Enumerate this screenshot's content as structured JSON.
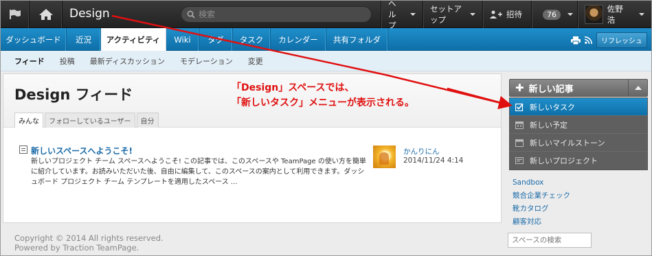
{
  "topbar": {
    "space_title": "Design",
    "search_placeholder": "検索",
    "help_label": "ヘルプ",
    "setup_label": "セットアップ",
    "invite_label": "招待",
    "notification_count": "76",
    "user_name": "佐野 浩"
  },
  "nav": {
    "tabs": [
      {
        "label": "ダッシュボード"
      },
      {
        "label": "近況"
      },
      {
        "label": "アクティビティ"
      },
      {
        "label": "Wiki"
      },
      {
        "label": "タグ"
      },
      {
        "label": "タスク"
      },
      {
        "label": "カレンダー"
      },
      {
        "label": "共有フォルダ"
      }
    ],
    "refresh_label": "リフレッシュ"
  },
  "subnav": {
    "items": [
      {
        "label": "フィード"
      },
      {
        "label": "投稿"
      },
      {
        "label": "最新ディスカッション"
      },
      {
        "label": "モデレーション"
      },
      {
        "label": "変更"
      }
    ]
  },
  "feed": {
    "title": "Design フィード",
    "tabs": [
      {
        "label": "みんな"
      },
      {
        "label": "フォローしているユーザー"
      },
      {
        "label": "自分"
      }
    ],
    "post": {
      "title": "新しいスペースへようこそ!",
      "body": "新しいプロジェクト チーム スペースへようこそ! この記事では、このスペースや TeamPage の使い方を簡単に紹介しています。お読みいただいた後、自由に編集して、このスペースの案内として利用できます。ダッシュボード プロジェクト チーム テンプレートを適用したスペース ...",
      "author": "かんりにん",
      "date": "2014/11/24 4:14"
    }
  },
  "annotation": {
    "line1": "「Design」スペースでは、",
    "line2": "「新しいタスク」メニューが表示される。",
    "color": "#e01010"
  },
  "sidebar": {
    "new_button_label": "新しい記事",
    "menu_items": [
      {
        "label": "新しいタスク",
        "icon": "checkbox-icon"
      },
      {
        "label": "新しい予定",
        "icon": "calendar-icon"
      },
      {
        "label": "新しいマイルストーン",
        "icon": "calendar-icon"
      },
      {
        "label": "新しいプロジェクト",
        "icon": "project-icon"
      }
    ],
    "links": [
      {
        "label": "Sandbox"
      },
      {
        "label": "競合企業チェック"
      },
      {
        "label": "靴カタログ"
      },
      {
        "label": "顧客対応"
      }
    ],
    "search_placeholder": "スペースの検索"
  },
  "footer": {
    "copyright": "Copyright © 2014 All rights reserved.",
    "powered": "Powered by Traction TeamPage."
  },
  "colors": {
    "accent": "#1f8fcb",
    "topbar": "#2b2b2b",
    "annotation": "#e01010"
  }
}
